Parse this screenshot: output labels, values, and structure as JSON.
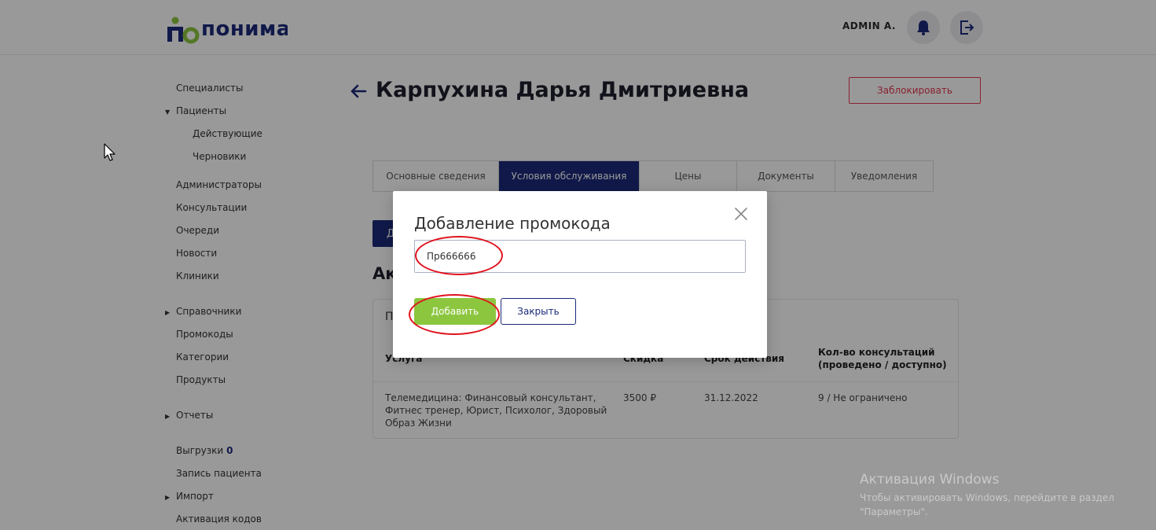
{
  "header": {
    "logo_main": "понимаю",
    "admin_name": "ADMIN A."
  },
  "sidebar": {
    "items": [
      {
        "label": "Специалисты"
      },
      {
        "label": "Пациенты"
      },
      {
        "label": "Действующие"
      },
      {
        "label": "Черновики"
      },
      {
        "label": "Администраторы"
      },
      {
        "label": "Консультации"
      },
      {
        "label": "Очереди"
      },
      {
        "label": "Новости"
      },
      {
        "label": "Клиники"
      },
      {
        "label": "Справочники"
      },
      {
        "label": "Промокоды"
      },
      {
        "label": "Категории"
      },
      {
        "label": "Продукты"
      },
      {
        "label": "Отчеты"
      },
      {
        "label": "Выгрузки",
        "badge": "0"
      },
      {
        "label": "Запись пациента"
      },
      {
        "label": "Импорт"
      },
      {
        "label": "Активация кодов"
      }
    ]
  },
  "page": {
    "title": "Карпухина Дарья Дмитриевна",
    "block_label": "Заблокировать"
  },
  "tabs": [
    {
      "label": "Основные сведения"
    },
    {
      "label": "Условия обслуживания"
    },
    {
      "label": "Цены"
    },
    {
      "label": "Документы"
    },
    {
      "label": "Уведомления"
    }
  ],
  "content": {
    "add_button_partial": "Д",
    "section_heading_partial": "Ак",
    "card_heading_partial": "П",
    "table": {
      "headers": [
        "Услуга",
        "Скидка",
        "Срок действия",
        "Кол-во консультаций (проведено / доступно)"
      ],
      "rows": [
        [
          "Телемедицина: Финансовый консультант, Фитнес тренер, Юрист, Психолог, Здоровый Образ Жизни",
          "3500 ₽",
          "31.12.2022",
          "9 / Не ограничено"
        ]
      ]
    }
  },
  "modal": {
    "title": "Добавление промокода",
    "input_value": "Пр666666",
    "submit_label": "Добавить",
    "close_label": "Закрыть"
  },
  "watermark": {
    "title": "Активация Windows",
    "subtitle": "Чтобы активировать Windows, перейдите в раздел \"Параметры\"."
  },
  "colors": {
    "brand": "#1b2a7a",
    "accent_green": "#8cc63f",
    "danger": "#e53950",
    "annotation_red": "#e0141e"
  }
}
